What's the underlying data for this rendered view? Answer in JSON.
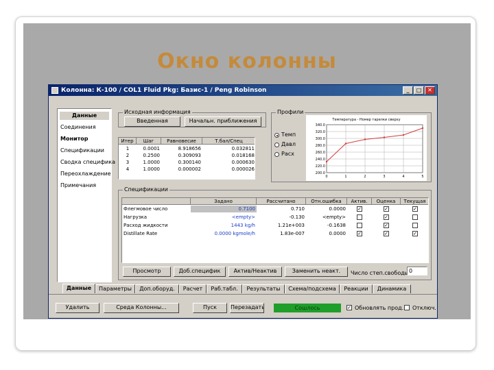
{
  "slide": {
    "title": "Окно колонны"
  },
  "window": {
    "title": "Колонна: К-100 / COL1  Fluid Pkg: Базис-1 / Peng Robinson",
    "controls": [
      "_",
      "□",
      "✕"
    ]
  },
  "nav": {
    "header": "Данные",
    "items": [
      "Соединения",
      "Монитор",
      "Спецификации",
      "Сводка специфика",
      "Переохлаждение",
      "Примечания"
    ],
    "active": "Монитор"
  },
  "initial": {
    "label": "Исходная информация",
    "btn_entered": "Введенная",
    "btn_initial": "Начальн. приближения"
  },
  "iter_table": {
    "headers": [
      "Итер",
      "Шаг",
      "Равновесие",
      "Т.бал/Спец"
    ],
    "rows": [
      [
        "1",
        "0.0001",
        "8.918656",
        "0.032811"
      ],
      [
        "2",
        "0.2500",
        "0.309093",
        "0.018168"
      ],
      [
        "3",
        "1.0000",
        "0.300140",
        "0.000630"
      ],
      [
        "4",
        "1.0000",
        "0.000002",
        "0.000026"
      ]
    ]
  },
  "profiles": {
    "label": "Профили",
    "options": [
      "Темп",
      "Давл",
      "Расх"
    ],
    "selected": "Темп"
  },
  "chart_data": {
    "type": "line",
    "title": "Температура - Номер тарелки сверху",
    "x": [
      0,
      1,
      2,
      3,
      4,
      5
    ],
    "values": [
      232,
      285,
      297,
      303,
      310,
      330
    ],
    "xticks": [
      "0",
      "1",
      "2",
      "3",
      "4",
      "5"
    ],
    "yticks": [
      "340.0",
      "320.0",
      "300.0",
      "280.0",
      "260.0",
      "240.0",
      "220.0",
      "200.0"
    ],
    "xlim": [
      0,
      5
    ],
    "ylim": [
      200,
      340
    ],
    "grid": true,
    "color": "#d23b3b"
  },
  "specs": {
    "label": "Спецификации",
    "headers": [
      "",
      "Задано",
      "Рассчитано",
      "Отн.ошибка",
      "Актив.",
      "Оценка",
      "Текущая"
    ],
    "rows": [
      {
        "name": "Флегмовое число",
        "spec": "0.7100",
        "calc": "0.710",
        "err": "0.0000",
        "active": true,
        "est": true,
        "cur": true
      },
      {
        "name": "Нагрузка",
        "spec": "<empty>",
        "calc": "-0.130",
        "err": "<empty>",
        "active": false,
        "est": true,
        "cur": false
      },
      {
        "name": "Расход жидкости",
        "spec": "1443 kg/h",
        "calc": "1.21e+003",
        "err": "-0.1638",
        "active": false,
        "est": true,
        "cur": false
      },
      {
        "name": "Distillate Rate",
        "spec": "0.0000 kgmole/h",
        "calc": "1.83e-007",
        "err": "0.0000",
        "active": true,
        "est": true,
        "cur": true
      }
    ],
    "buttons": [
      "Просмотр",
      "Доб.специфик",
      "Актив/Неактив",
      "Заменить неакт."
    ],
    "dof_label": "Число степ.свободы",
    "dof_value": "0"
  },
  "tabs": [
    "Данные",
    "Параметры",
    "Доп.оборуд.",
    "Расчет",
    "Раб.табл.",
    "Результаты",
    "Схема/подсхема",
    "Реакции",
    "Динамика"
  ],
  "bottom": {
    "delete": "Удалить",
    "env": "Среда Колонны...",
    "run": "Пуск",
    "reset": "Перезадать",
    "status": "Сошлось",
    "status_color": "#1f9e2a",
    "update": "Обновлять прод.",
    "ignore": "Отключ."
  }
}
